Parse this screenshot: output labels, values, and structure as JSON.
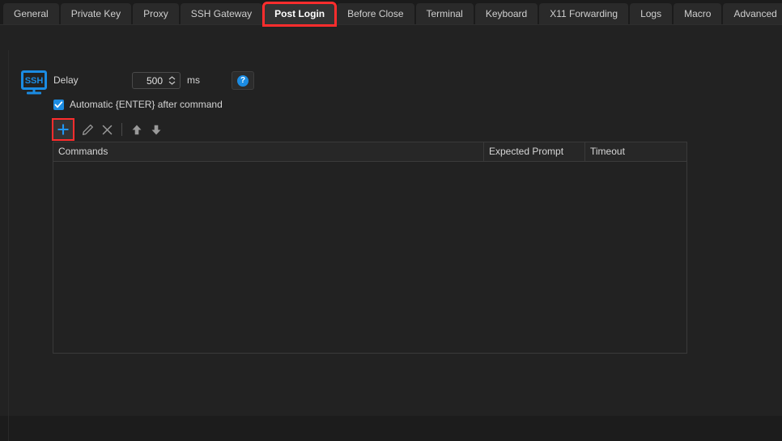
{
  "tabs": {
    "items": [
      {
        "label": "General",
        "active": false,
        "highlighted": false
      },
      {
        "label": "Private Key",
        "active": false,
        "highlighted": false
      },
      {
        "label": "Proxy",
        "active": false,
        "highlighted": false
      },
      {
        "label": "SSH Gateway",
        "active": false,
        "highlighted": false
      },
      {
        "label": "Post Login",
        "active": true,
        "highlighted": true
      },
      {
        "label": "Before Close",
        "active": false,
        "highlighted": false
      },
      {
        "label": "Terminal",
        "active": false,
        "highlighted": false
      },
      {
        "label": "Keyboard",
        "active": false,
        "highlighted": false
      },
      {
        "label": "X11 Forwarding",
        "active": false,
        "highlighted": false
      },
      {
        "label": "Logs",
        "active": false,
        "highlighted": false
      },
      {
        "label": "Macro",
        "active": false,
        "highlighted": false
      },
      {
        "label": "Advanced",
        "active": false,
        "highlighted": false
      }
    ],
    "nav_prev_glyph": "‹",
    "nav_next_glyph": "›"
  },
  "panel": {
    "icon_name": "ssh-monitor-icon",
    "icon_text": "SSH",
    "delay_label": "Delay",
    "delay_value": "500",
    "delay_unit": "ms",
    "help_glyph": "?",
    "checkbox": {
      "label": "Automatic {ENTER} after command",
      "checked": true
    }
  },
  "toolbar": {
    "add_label": "+",
    "buttons": [
      {
        "name": "add-command-button",
        "icon": "plus-icon"
      },
      {
        "name": "edit-command-button",
        "icon": "pencil-icon"
      },
      {
        "name": "delete-command-button",
        "icon": "close-x-icon"
      },
      {
        "name": "move-up-button",
        "icon": "arrow-up-icon"
      },
      {
        "name": "move-down-button",
        "icon": "arrow-down-icon"
      }
    ]
  },
  "table": {
    "columns": [
      "Commands",
      "Expected Prompt",
      "Timeout"
    ],
    "rows": []
  },
  "colors": {
    "accent": "#1b8ce3",
    "highlight": "#ff2d2d",
    "background": "#222222",
    "tabbar_background": "#1b1b1b",
    "tab_background": "#2a2a2a",
    "tab_active_background": "#333333",
    "border": "#3a3a3a",
    "text": "#d4d4d4"
  }
}
